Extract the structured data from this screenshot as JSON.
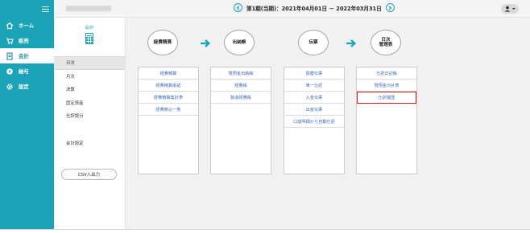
{
  "sidebar": {
    "items": [
      {
        "label": "ホーム",
        "icon": "home-icon"
      },
      {
        "label": "販売",
        "icon": "cart-icon"
      },
      {
        "label": "会計",
        "icon": "ledger-icon"
      },
      {
        "label": "給与",
        "icon": "coin-icon"
      },
      {
        "label": "設定",
        "icon": "gear-icon"
      }
    ],
    "active": "会計"
  },
  "header": {
    "company_blurred": true,
    "period": "第1期(当期)：2021年04月01日 － 2022年03月31日"
  },
  "subsidebar": {
    "title": "会計",
    "items": [
      "日次",
      "月次",
      "決算",
      "固定資産",
      "仕訳按分"
    ],
    "active": "日次",
    "settings": "会計設定",
    "csv_button": "CSV入出力"
  },
  "flow": {
    "steps": [
      {
        "title_lines": [
          "経費精算"
        ],
        "links": [
          "経費精算",
          "経費精算承認",
          "経費精算集計表",
          "経費節込一覧"
        ]
      },
      {
        "title_lines": [
          "出納帳"
        ],
        "links": [
          "現預金出納帳",
          "経費帳",
          "製造経費帳"
        ]
      },
      {
        "title_lines": [
          "伝票"
        ],
        "links": [
          "振替伝票",
          "単一仕訳",
          "入金伝票",
          "出金伝票",
          "口座明細から自動仕訳"
        ]
      },
      {
        "title_lines": [
          "日次",
          "管理表"
        ],
        "links": [
          "仕訳日記帳",
          "現預金日計表",
          "仕訳履歴"
        ]
      }
    ],
    "highlighted_link": "仕訳履歴"
  },
  "colors": {
    "sidebar": "#1ba3b8",
    "arrow": "#1ba3b8",
    "link": "#3f6db3",
    "highlight": "#d21b1b"
  }
}
